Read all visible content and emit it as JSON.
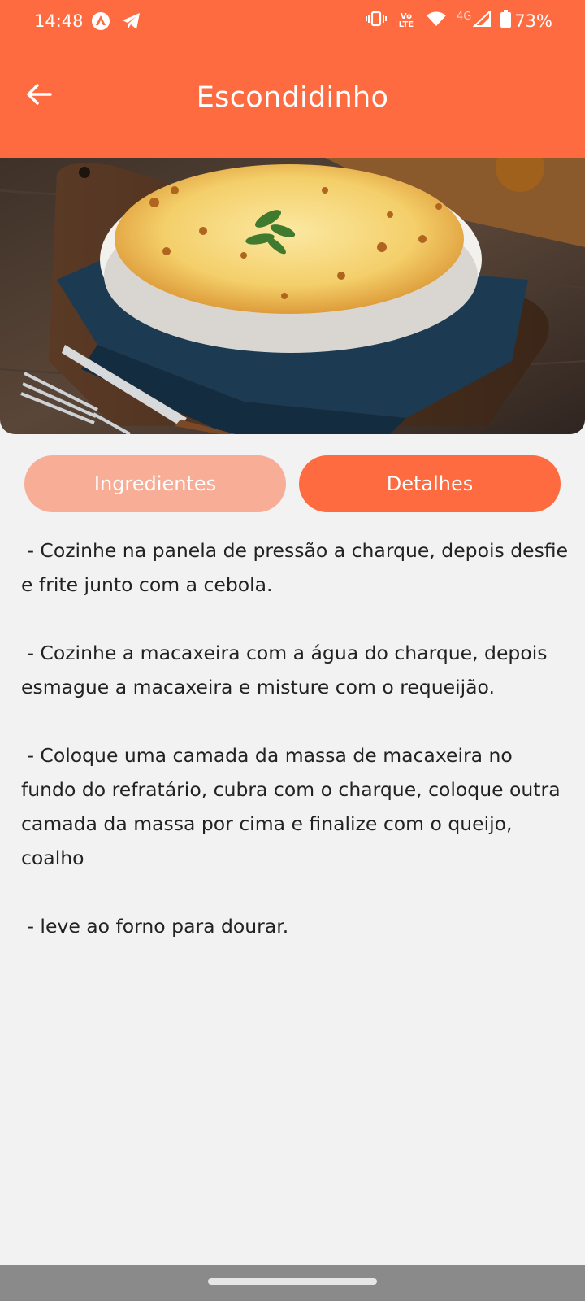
{
  "status_bar": {
    "time": "14:48",
    "network_label": "4G",
    "battery": "73%",
    "volte_label": "Vo LTE"
  },
  "app_bar": {
    "title": "Escondidinho",
    "back_icon": "arrow-left-icon"
  },
  "hero_image": {
    "description_icon": "food-photo"
  },
  "tabs": [
    {
      "label": "Ingredientes",
      "active": false
    },
    {
      "label": "Detalhes",
      "active": true
    }
  ],
  "steps": [
    " - Cozinhe na panela de pressão a charque, depois desfie e frite junto com a cebola.",
    " - Cozinhe a macaxeira com a água do charque, depois esmague a macaxeira e misture com o requeijão.",
    " - Coloque uma camada da massa de macaxeira no fundo do refratário, cubra com o charque, coloque outra camada da massa por cima e finalize com o queijo, coalho",
    " - leve ao forno para dourar."
  ],
  "colors": {
    "primary": "#ff6b40",
    "tab_inactive": "#f8ad97",
    "background": "#f2f2f2",
    "text": "#222222"
  }
}
